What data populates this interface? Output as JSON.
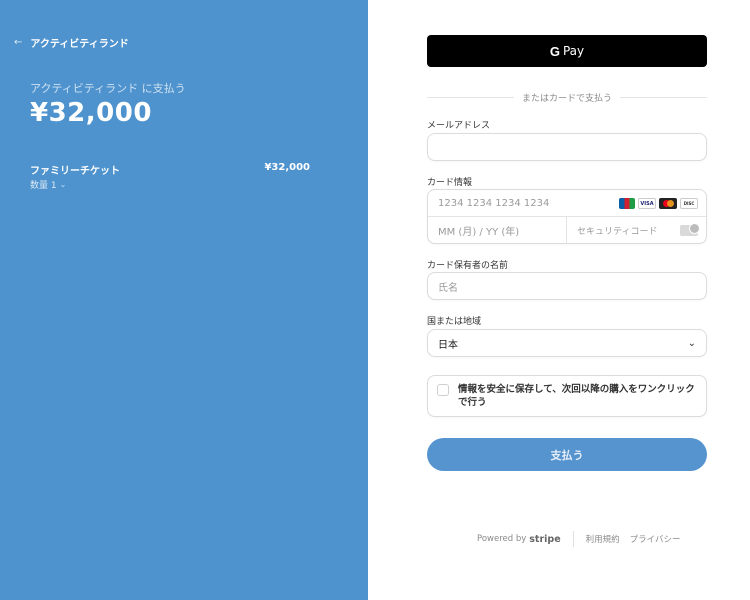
{
  "left": {
    "back_label": "アクティビティランド",
    "pay_to": "アクティビティランド に支払う",
    "total": "¥32,000",
    "item": {
      "name": "ファミリーチケット",
      "price": "¥32,000",
      "quantity": "数量 1"
    }
  },
  "right": {
    "gpay_label": "Pay",
    "divider_text": "またはカードで支払う",
    "email": {
      "label": "メールアドレス",
      "value": "",
      "placeholder": ""
    },
    "card": {
      "label": "カード情報",
      "number_placeholder": "1234 1234 1234 1234",
      "expiry_placeholder": "MM (月) / YY (年)",
      "cvc_placeholder": "セキュリティコード",
      "brands": [
        "JCB",
        "VISA",
        "Mastercard",
        "DISCOVER"
      ]
    },
    "name": {
      "label": "カード保有者の名前",
      "placeholder": "氏名"
    },
    "country": {
      "label": "国または地域",
      "value": "日本"
    },
    "save_text": "情報を安全に保存して、次回以降の購入をワンクリックで行う",
    "pay_button": "支払う",
    "footer": {
      "powered_by": "Powered by",
      "stripe": "stripe",
      "terms": "利用規約",
      "privacy": "プライバシー"
    }
  },
  "colors": {
    "left_bg": "#4f93ce",
    "pay_button": "#5694cf"
  }
}
